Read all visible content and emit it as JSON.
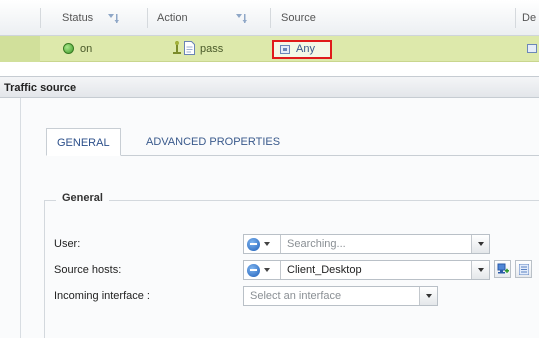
{
  "grid": {
    "columns": [
      {
        "label": "Status"
      },
      {
        "label": "Action"
      },
      {
        "label": "Source"
      },
      {
        "label": "De"
      }
    ],
    "row": {
      "status": "on",
      "action": "pass",
      "source": "Any"
    }
  },
  "panel": {
    "title": "Traffic source",
    "tabs": [
      {
        "label": "GENERAL",
        "active": true
      },
      {
        "label": "ADVANCED PROPERTIES",
        "active": false
      }
    ],
    "section_legend": "General",
    "fields": {
      "user": {
        "label": "User:",
        "value": "Searching..."
      },
      "source_hosts": {
        "label": "Source hosts:",
        "value": "Client_Desktop"
      },
      "incoming_interface": {
        "label": "Incoming interface :",
        "value": "Select an interface"
      }
    }
  },
  "colors": {
    "selected_row": "#dde9ab",
    "highlight_border": "#e01b1b",
    "tab_text": "#3a5a8c"
  }
}
